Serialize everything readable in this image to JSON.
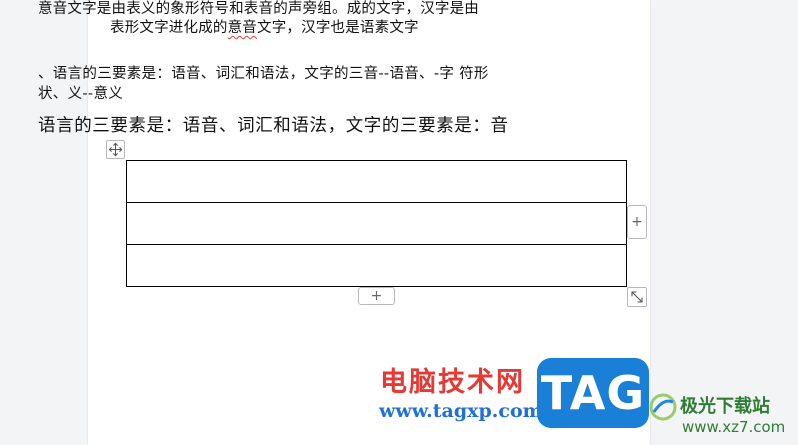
{
  "document": {
    "line1": "意音文字是由表义的象形符号和表音的声旁组。成的文字，汉字是由",
    "line2_before": "表形文字进化成的",
    "line2_underlined": "意音",
    "line2_after": "文字，汉字也是语素文字",
    "line3": "、语言的三要素是：语音、词汇和语法，文字的三音--语音、-字  符形",
    "line4": "状、义--意义",
    "line5": "语言的三要素是：语音、词汇和语法，文字的三要素是：音"
  },
  "table": {
    "rows": 3,
    "columns": 1,
    "cells": [
      [
        ""
      ],
      [
        ""
      ],
      [
        ""
      ]
    ]
  },
  "controls": {
    "add_column_label": "+",
    "add_row_label": "+"
  },
  "watermark": {
    "site_name_cn": "电脑技术网",
    "site_url": "www.tagxp.com",
    "tag_logo_text": "TAG",
    "xz_name_cn": "极光下载站",
    "xz_url": "www.xz7.com"
  },
  "colors": {
    "page_background": "#ffffff",
    "workspace_background": "#f3f4f6",
    "watermark_red": "#e53935",
    "watermark_blue": "#1e6fd9",
    "tag_logo_blue": "#1a7fd6",
    "xz_green": "#2e7d32"
  },
  "icons": {
    "table_move": "move-arrows-icon",
    "table_resize": "resize-diagonal-icon"
  }
}
